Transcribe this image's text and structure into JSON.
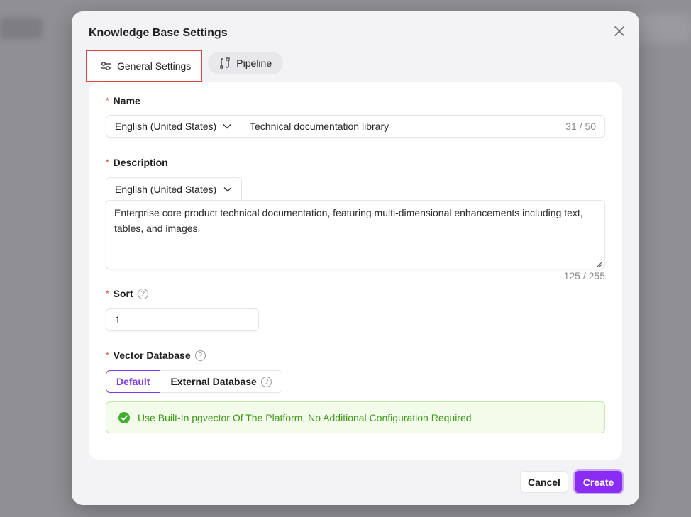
{
  "modal": {
    "title": "Knowledge Base Settings",
    "tabs": [
      {
        "label": "General Settings",
        "icon": "sliders-icon",
        "active": true
      },
      {
        "label": "Pipeline",
        "icon": "pipeline-icon",
        "active": false
      }
    ]
  },
  "form": {
    "name": {
      "label": "Name",
      "language": "English (United States)",
      "value": "Technical documentation library",
      "counter": "31 / 50"
    },
    "description": {
      "label": "Description",
      "language": "English (United States)",
      "value": "Enterprise core product technical documentation, featuring multi-dimensional enhancements including text, tables, and images.",
      "counter": "125 / 255"
    },
    "sort": {
      "label": "Sort",
      "value": "1"
    },
    "vector_database": {
      "label": "Vector Database",
      "options": [
        {
          "label": "Default",
          "selected": true
        },
        {
          "label": "External Database",
          "selected": false
        }
      ],
      "info": "Use Built-In pgvector Of The Platform, No Additional Configuration Required"
    }
  },
  "footer": {
    "cancel_label": "Cancel",
    "create_label": "Create"
  },
  "colors": {
    "accent": "#8b2cf5",
    "required": "#e2453c",
    "success": "#3d9a1a"
  }
}
